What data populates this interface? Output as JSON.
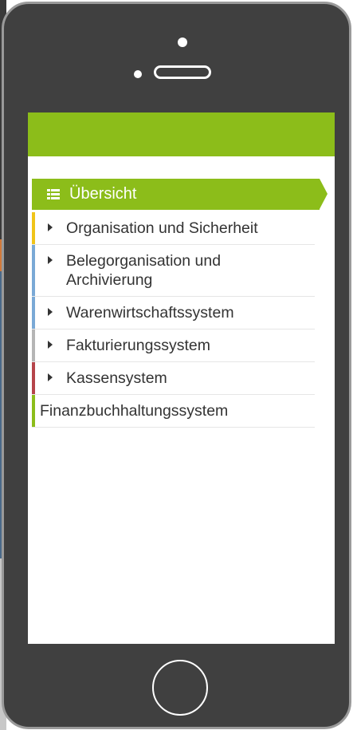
{
  "overview": {
    "label": "Übersicht",
    "icon": "list-icon",
    "color": "#8cbd1a"
  },
  "menu": {
    "items": [
      {
        "label": "Organisation und Sicherheit",
        "color": "#f0c419",
        "has_arrow": true
      },
      {
        "label": "Belegorganisation und Archivierung",
        "color": "#7aa9d6",
        "has_arrow": true
      },
      {
        "label": "Warenwirtschaftssystem",
        "color": "#7aa9d6",
        "has_arrow": true
      },
      {
        "label": "Fakturierungssystem",
        "color": "#b5b5b5",
        "has_arrow": true
      },
      {
        "label": "Kassensystem",
        "color": "#b5444a",
        "has_arrow": true
      },
      {
        "label": "Finanzbuchhaltungssystem",
        "color": "#8cbd1a",
        "has_arrow": false
      }
    ]
  }
}
